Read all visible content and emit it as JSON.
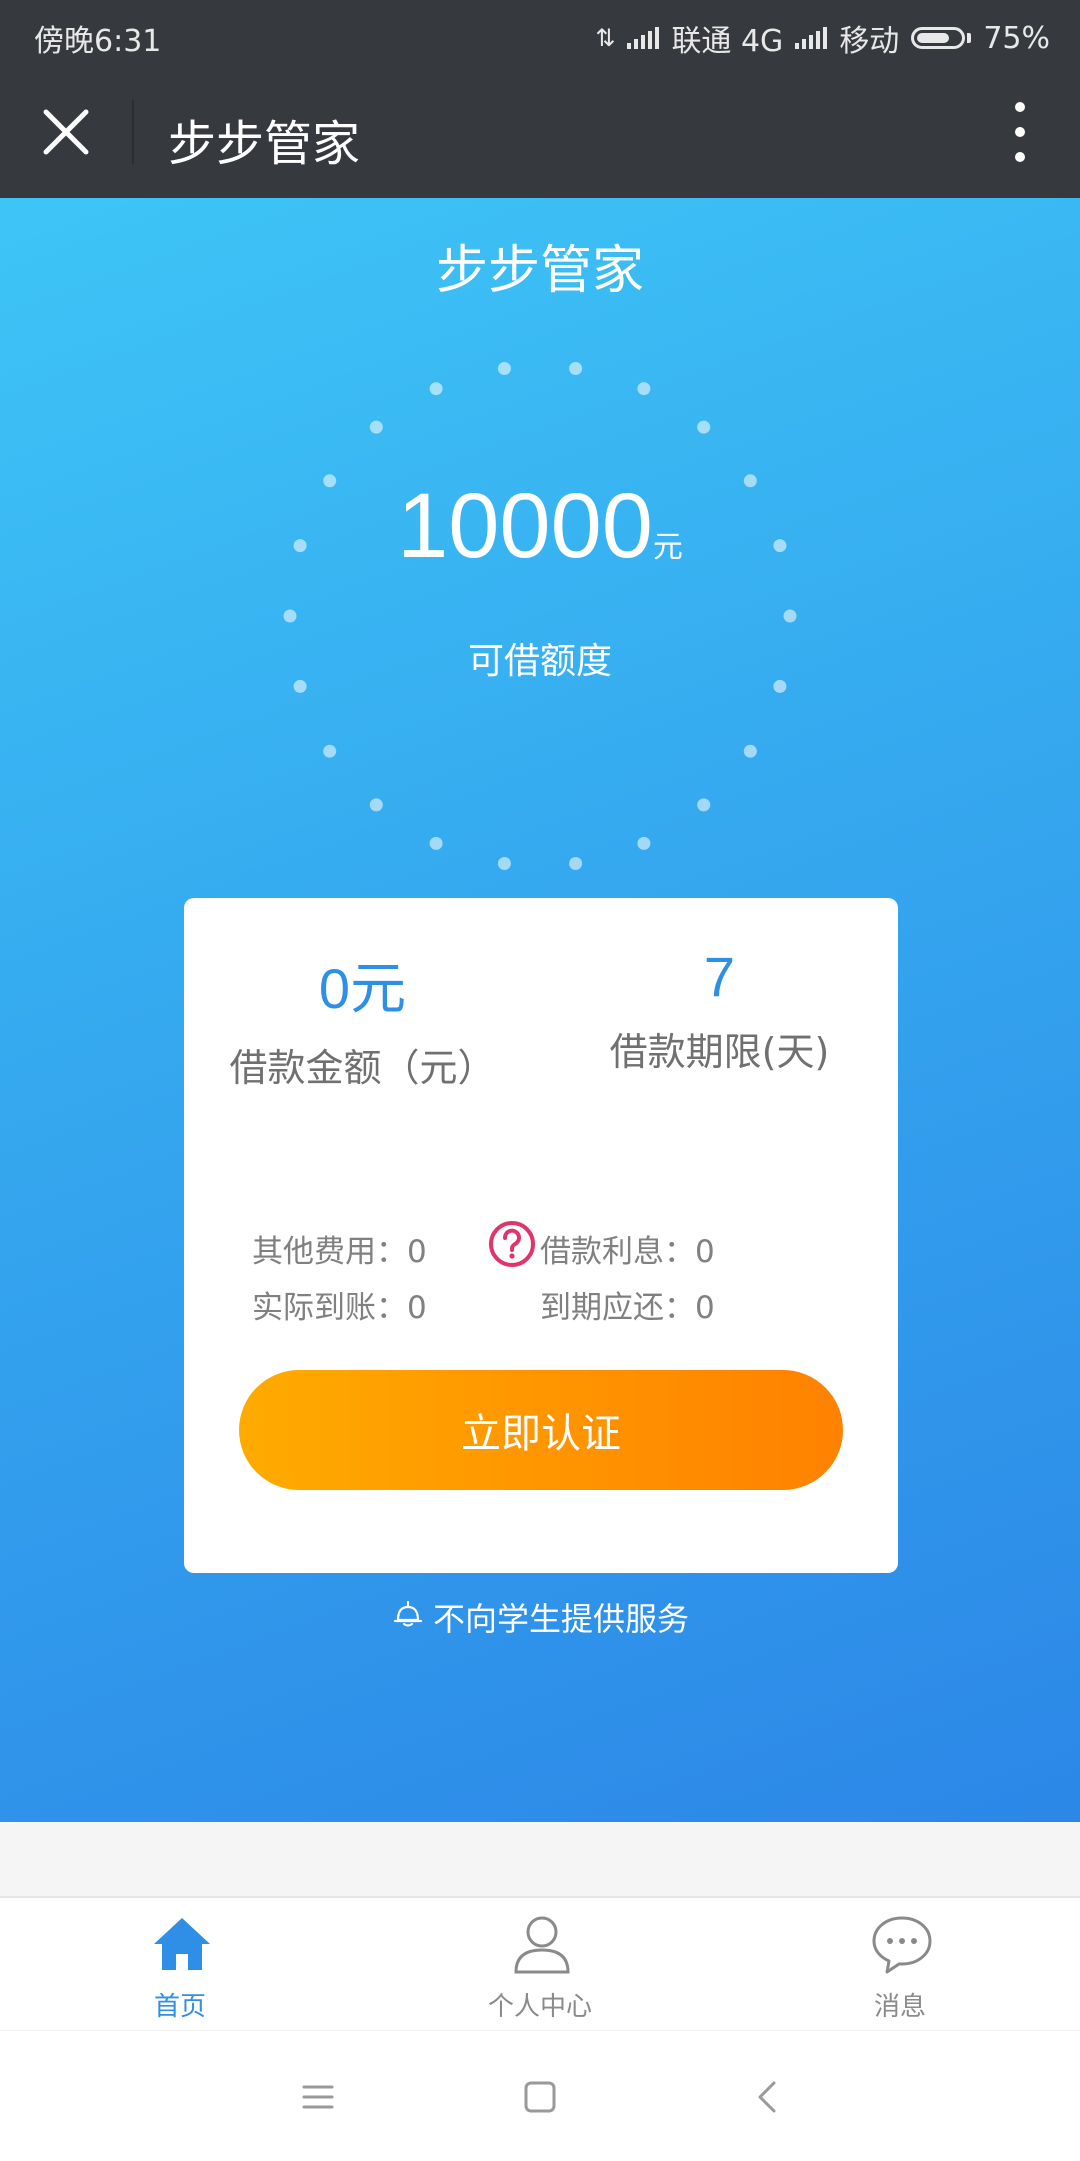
{
  "status_bar": {
    "time": "傍晚6:31",
    "carrier1": "联通 4G",
    "carrier2": "移动",
    "battery": "75%",
    "battery_level": 0.75
  },
  "topbar": {
    "title": "步步管家",
    "close_icon": "close-icon",
    "more_icon": "more-vertical-icon"
  },
  "hero": {
    "title": "步步管家",
    "amount": "10000",
    "amount_unit": "元",
    "amount_label": "可借额度"
  },
  "card": {
    "loan_amount_value": "0元",
    "loan_amount_label": "借款金额（元）",
    "loan_term_value": "7",
    "loan_term_label": "借款期限(天)",
    "other_fees": "其他费用：0",
    "interest": "借款利息：0",
    "actual_received": "实际到账：0",
    "due_repay": "到期应还：0",
    "button_label": "立即认证"
  },
  "notice": "不向学生提供服务",
  "tabs": [
    {
      "label": "首页",
      "icon": "home-icon",
      "active": true
    },
    {
      "label": "个人中心",
      "icon": "user-icon",
      "active": false
    },
    {
      "label": "消息",
      "icon": "message-icon",
      "active": false
    }
  ],
  "colors": {
    "accent": "#2f8fe6",
    "button_start": "#ffab00",
    "button_end": "#ff8100",
    "help_icon": "#e0356b"
  }
}
